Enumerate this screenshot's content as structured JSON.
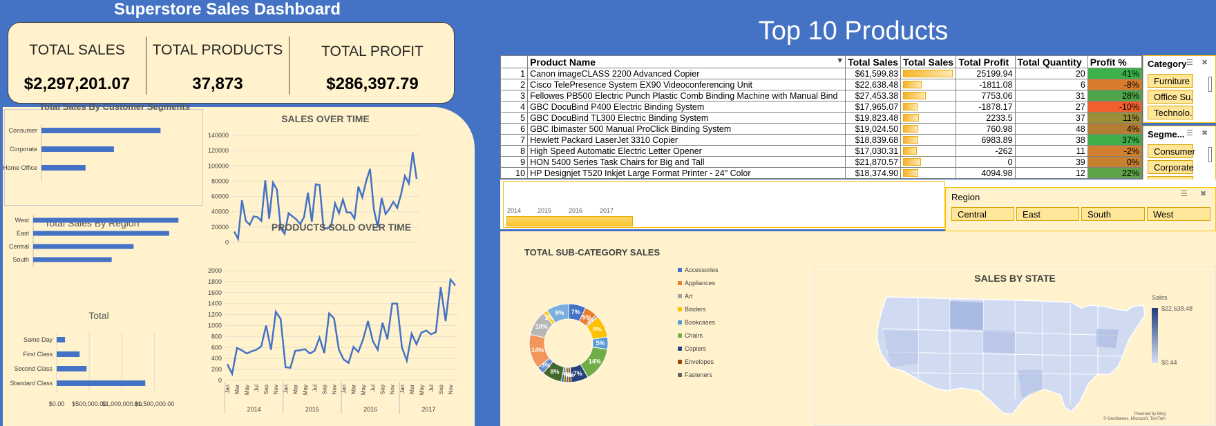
{
  "header": {
    "title": "Superstore Sales Dashboard"
  },
  "kpis": [
    {
      "label": "TOTAL SALES",
      "value": "$2,297,201.07"
    },
    {
      "label": "TOTAL PRODUCTS",
      "value": "37,873"
    },
    {
      "label": "TOTAL PROFIT",
      "value": "$286,397.79"
    }
  ],
  "top10": {
    "title": "Top 10 Products",
    "columns": [
      "Product Name",
      "Total Sales",
      "Total Sales",
      "Total Profit",
      "Total Quantity",
      "Profit %"
    ],
    "rows": [
      {
        "rank": "1",
        "name": "Canon imageCLASS 2200 Advanced Copier",
        "sales": "$61,599.83",
        "bar": 1.0,
        "profit": "25199.94",
        "qty": "20",
        "pct": "41%",
        "color": "#3cb34a"
      },
      {
        "rank": "2",
        "name": "Cisco TelePresence System EX90 Videoconferencing Unit",
        "sales": "$22,638.48",
        "bar": 0.37,
        "profit": "-1811.08",
        "qty": "6",
        "pct": "-8%",
        "color": "#d97b2a"
      },
      {
        "rank": "3",
        "name": "Fellowes PB500 Electric Punch Plastic Comb Binding Machine with Manual Bind",
        "sales": "$27,453.38",
        "bar": 0.45,
        "profit": "7753.06",
        "qty": "31",
        "pct": "28%",
        "color": "#4ea64a"
      },
      {
        "rank": "4",
        "name": "GBC DocuBind P400 Electric Binding System",
        "sales": "$17,965.07",
        "bar": 0.29,
        "profit": "-1878.17",
        "qty": "27",
        "pct": "-10%",
        "color": "#f0602c"
      },
      {
        "rank": "5",
        "name": "GBC DocuBind TL300 Electric Binding System",
        "sales": "$19,823.48",
        "bar": 0.32,
        "profit": "2233.5",
        "qty": "37",
        "pct": "11%",
        "color": "#9c8f3a"
      },
      {
        "rank": "6",
        "name": "GBC Ibimaster 500 Manual ProClick Binding System",
        "sales": "$19,024.50",
        "bar": 0.31,
        "profit": "760.98",
        "qty": "48",
        "pct": "4%",
        "color": "#b27d32"
      },
      {
        "rank": "7",
        "name": "Hewlett Packard LaserJet 3310 Copier",
        "sales": "$18,839.68",
        "bar": 0.31,
        "profit": "6983.89",
        "qty": "38",
        "pct": "37%",
        "color": "#41ae49"
      },
      {
        "rank": "8",
        "name": "High Speed Automatic Electric Letter Opener",
        "sales": "$17,030.31",
        "bar": 0.28,
        "profit": "-262",
        "qty": "11",
        "pct": "-2%",
        "color": "#cf7f2e"
      },
      {
        "rank": "9",
        "name": "HON 5400 Series Task Chairs for Big and Tall",
        "sales": "$21,870.57",
        "bar": 0.36,
        "profit": "0",
        "qty": "39",
        "pct": "0%",
        "color": "#c68030"
      },
      {
        "rank": "10",
        "name": "HP Designjet T520 Inkjet Large Format Printer - 24\" Color",
        "sales": "$18,374.90",
        "bar": 0.3,
        "profit": "4094.98",
        "qty": "12",
        "pct": "22%",
        "color": "#5ea247"
      }
    ]
  },
  "slicers": {
    "category": {
      "title": "Category",
      "items": [
        "Furniture",
        "Office Su...",
        "Technolo..."
      ]
    },
    "segment": {
      "title": "Segme...",
      "items": [
        "Consumer",
        "Corporate",
        "Home Of..."
      ]
    },
    "region": {
      "title": "Region",
      "items": [
        "Central",
        "East",
        "South",
        "West"
      ]
    }
  },
  "timeline": {
    "years": [
      "2014",
      "2015",
      "2016",
      "2017"
    ]
  },
  "map": {
    "title": "SALES BY STATE",
    "legend_title": "Sales",
    "legend_max": "$22,638.48",
    "legend_min": "$0.44",
    "credit1": "Powered by Bing",
    "credit2": "© GeoNames, Microsoft, TomTom"
  },
  "chart_data": [
    {
      "type": "bar",
      "title": "Total Sales By Customer Segments",
      "categories": [
        "Consumer",
        "Corporate",
        "Home Office"
      ],
      "values": [
        1160000,
        706000,
        429000
      ],
      "xlim": [
        0,
        1400000
      ]
    },
    {
      "type": "bar",
      "title": "Total Sales By Region",
      "categories": [
        "West",
        "East",
        "Central",
        "South"
      ],
      "values": [
        725000,
        679000,
        501000,
        392000
      ],
      "xlim": [
        0,
        800000
      ]
    },
    {
      "type": "bar",
      "title": "Total",
      "categories": [
        "Same Day",
        "First Class",
        "Second Class",
        "Standard Class"
      ],
      "values": [
        128000,
        352000,
        459000,
        1358000
      ],
      "xlim": [
        0,
        1800000
      ],
      "tick_labels": [
        "$0.00",
        "$500,000.00",
        "$1,000,000.00",
        "$1,500,000.00"
      ]
    },
    {
      "type": "line",
      "title": "SALES OVER TIME",
      "ylim": [
        0,
        140000
      ],
      "yticks": [
        "0",
        "20000",
        "40000",
        "60000",
        "80000",
        "100000",
        "120000",
        "140000"
      ],
      "x": [
        "2014-01",
        "2014-02",
        "2014-03",
        "2014-04",
        "2014-05",
        "2014-06",
        "2014-07",
        "2014-08",
        "2014-09",
        "2014-10",
        "2014-11",
        "2014-12",
        "2015-01",
        "2015-02",
        "2015-03",
        "2015-04",
        "2015-05",
        "2015-06",
        "2015-07",
        "2015-08",
        "2015-09",
        "2015-10",
        "2015-11",
        "2015-12",
        "2016-01",
        "2016-02",
        "2016-03",
        "2016-04",
        "2016-05",
        "2016-06",
        "2016-07",
        "2016-08",
        "2016-09",
        "2016-10",
        "2016-11",
        "2016-12",
        "2017-01",
        "2017-02",
        "2017-03",
        "2017-04",
        "2017-05",
        "2017-06",
        "2017-07",
        "2017-08",
        "2017-09",
        "2017-10",
        "2017-11",
        "2017-12"
      ],
      "values": [
        14000,
        4500,
        55000,
        28000,
        23000,
        34000,
        33000,
        28000,
        81000,
        31000,
        78000,
        69000,
        18000,
        11000,
        38000,
        34000,
        30000,
        24000,
        33000,
        65000,
        27000,
        76000,
        75000,
        19000,
        18000,
        22000,
        51000,
        38000,
        56000,
        39000,
        39000,
        31000,
        73000,
        59000,
        80000,
        96000,
        43000,
        20000,
        58000,
        37000,
        44000,
        53000,
        45000,
        63000,
        87000,
        77000,
        118000,
        83000
      ],
      "x_years": [
        "2014",
        "2015",
        "2016",
        "2017"
      ],
      "x_months": [
        "Jan",
        "Mar",
        "May",
        "Jul",
        "Sep",
        "Nov"
      ]
    },
    {
      "type": "line",
      "title": "PRODUCTS SOLD OVER TIME",
      "ylim": [
        0,
        2000
      ],
      "yticks": [
        "0",
        "200",
        "400",
        "600",
        "800",
        "1000",
        "1200",
        "1400",
        "1600",
        "1800",
        "2000"
      ],
      "values": [
        297,
        120,
        590,
        550,
        490,
        530,
        560,
        620,
        1000,
        560,
        1250,
        1120,
        240,
        230,
        540,
        550,
        570,
        490,
        540,
        780,
        500,
        1220,
        1130,
        560,
        380,
        320,
        610,
        520,
        750,
        1080,
        720,
        560,
        1050,
        750,
        1400,
        1400,
        600,
        360,
        850,
        660,
        870,
        910,
        840,
        880,
        1700,
        1080,
        1840,
        1730
      ]
    },
    {
      "type": "pie",
      "title": "TOTAL SUB-CATEGORY SALES",
      "categories": [
        "Accessories",
        "Appliances",
        "Art",
        "Binders",
        "Bookcases",
        "Chairs",
        "Copiers",
        "Envelopes",
        "Fasteners"
      ],
      "legend_colors": [
        "#4472c4",
        "#ed7d31",
        "#a5a5a5",
        "#ffc000",
        "#5b9bd5",
        "#70ad47",
        "#264478",
        "#9e480e",
        "#636363"
      ],
      "slices": [
        {
          "label": "7%",
          "value": 7,
          "color": "#4472c4"
        },
        {
          "label": "5%",
          "value": 5,
          "color": "#ed7d31"
        },
        {
          "label": "1%",
          "value": 1,
          "color": "#a5a5a5"
        },
        {
          "label": "9%",
          "value": 9,
          "color": "#ffc000"
        },
        {
          "label": "5%",
          "value": 5,
          "color": "#5b9bd5"
        },
        {
          "label": "14%",
          "value": 14,
          "color": "#70ad47"
        },
        {
          "label": "7%",
          "value": 7,
          "color": "#264478"
        },
        {
          "label": "1%",
          "value": 1,
          "color": "#9e480e"
        },
        {
          "label": "1%",
          "value": 1,
          "color": "#636363"
        },
        {
          "label": "1%",
          "value": 1,
          "color": "#997300"
        },
        {
          "label": "1%",
          "value": 1,
          "color": "#255e91"
        },
        {
          "label": "8%",
          "value": 8,
          "color": "#43682b"
        },
        {
          "label": "3%",
          "value": 3,
          "color": "#698ed0"
        },
        {
          "label": "14%",
          "value": 14,
          "color": "#f1975a"
        },
        {
          "label": "10%",
          "value": 10,
          "color": "#b7b7b7"
        },
        {
          "label": "2%",
          "value": 2,
          "color": "#ffcd33"
        },
        {
          "label": "9%",
          "value": 9,
          "color": "#7cafdd"
        }
      ]
    }
  ]
}
